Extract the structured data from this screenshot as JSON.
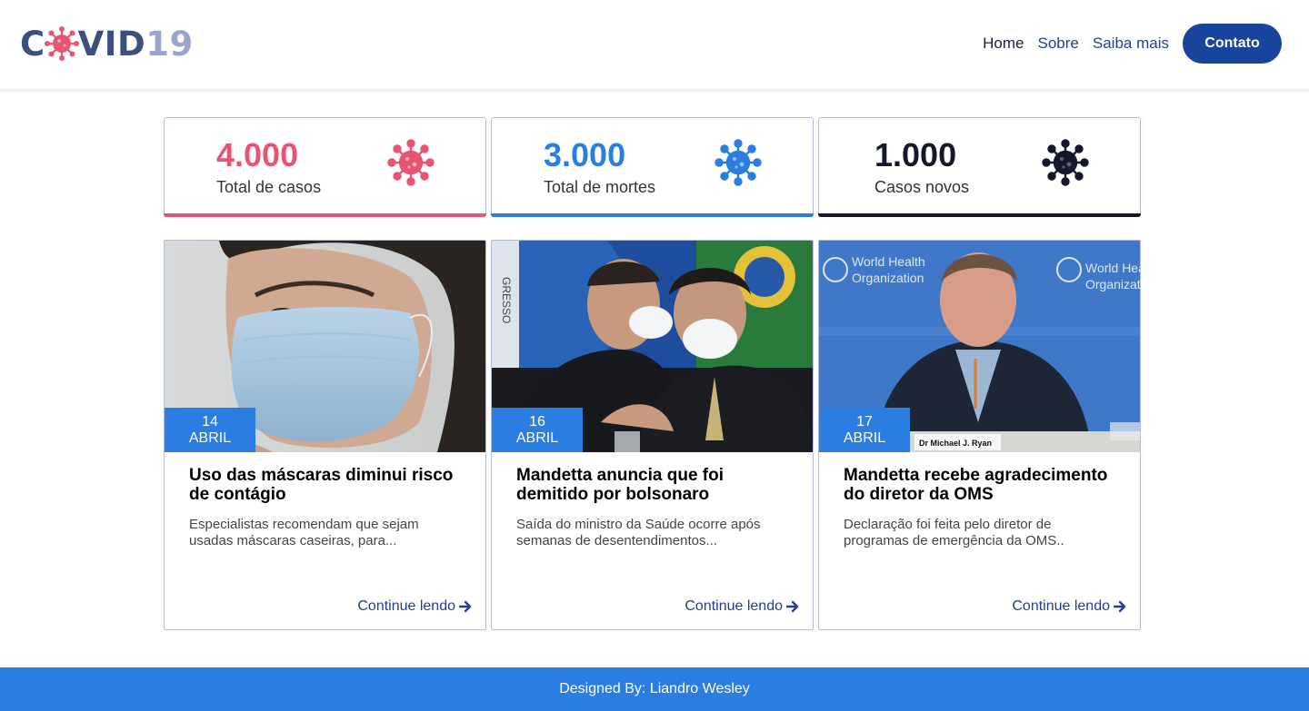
{
  "header": {
    "logo": {
      "part1": "C",
      "part2": "VID",
      "part3": "19"
    },
    "nav": [
      {
        "label": "Home"
      },
      {
        "label": "Sobre"
      },
      {
        "label": "Saiba mais"
      }
    ],
    "contact_label": "Contato"
  },
  "stats": [
    {
      "value": "4.000",
      "label": "Total de casos",
      "color": "#e85573",
      "icon": "virus-icon"
    },
    {
      "value": "3.000",
      "label": "Total de mortes",
      "color": "#2a7de1",
      "icon": "virus-icon"
    },
    {
      "value": "1.000",
      "label": "Casos novos",
      "color": "#15192b",
      "icon": "virus-icon"
    }
  ],
  "news": [
    {
      "day": "14",
      "month": "ABRIL",
      "title": "Uso das máscaras diminui risco de contágio",
      "excerpt": "Especialistas recomendam que sejam usadas máscaras caseiras, para...",
      "more": "Continue lendo"
    },
    {
      "day": "16",
      "month": "ABRIL",
      "title": "Mandetta anuncia que foi demitido por bolsonaro",
      "excerpt": "Saída do ministro da Saúde ocorre após semanas de desentendimentos...",
      "more": "Continue lendo"
    },
    {
      "day": "17",
      "month": "ABRIL",
      "title": "Mandetta recebe agradecimento do diretor da OMS",
      "excerpt": "Declaração foi feita pelo diretor de programas de emergência da OMS..",
      "more": "Continue lendo"
    }
  ],
  "photo_text": {
    "who_1": "World Health",
    "who_2": "Organization",
    "who_3": "World Heal",
    "who_4": "Organizati",
    "nameplate": "Dr Michael J. Ryan",
    "gresso": "GRESSO"
  },
  "footer": {
    "text": "Designed By: Liandro Wesley"
  }
}
